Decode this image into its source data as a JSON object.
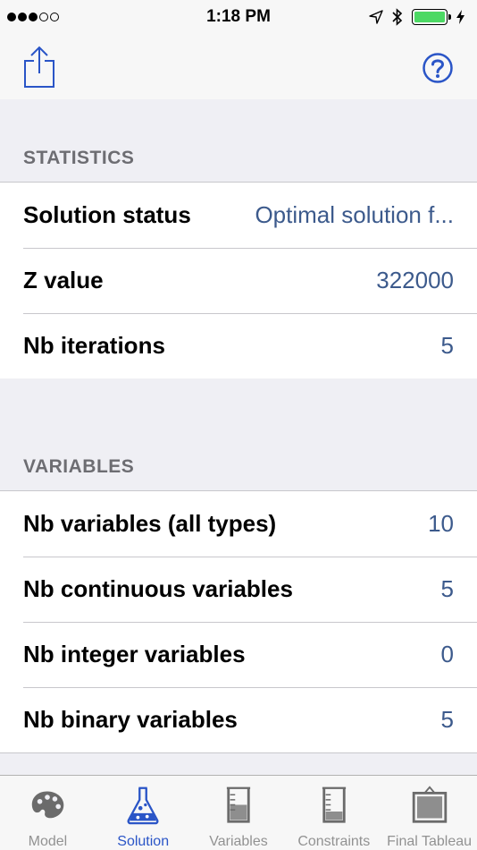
{
  "status_bar": {
    "time": "1:18 PM",
    "battery_color": "#4cd964"
  },
  "toolbar": {
    "share_icon": "share-icon",
    "help_icon": "help-icon"
  },
  "statistics": {
    "header": "STATISTICS",
    "rows": [
      {
        "label": "Solution status",
        "value": "Optimal solution f..."
      },
      {
        "label": "Z value",
        "value": "322000"
      },
      {
        "label": "Nb iterations",
        "value": "5"
      }
    ]
  },
  "variables": {
    "header": "VARIABLES",
    "rows": [
      {
        "label": "Nb variables (all types)",
        "value": "10"
      },
      {
        "label": "Nb continuous variables",
        "value": "5"
      },
      {
        "label": "Nb integer variables",
        "value": "0"
      },
      {
        "label": "Nb binary variables",
        "value": "5"
      }
    ]
  },
  "tabs": [
    {
      "label": "Model",
      "icon": "palette-icon"
    },
    {
      "label": "Solution",
      "icon": "flask-icon",
      "active": true
    },
    {
      "label": "Variables",
      "icon": "beaker-icon"
    },
    {
      "label": "Constraints",
      "icon": "beaker-icon"
    },
    {
      "label": "Final Tableau",
      "icon": "easel-icon"
    }
  ],
  "colors": {
    "accent": "#2a55c7",
    "value_text": "#3c5a8c",
    "header_text": "#6d6d72"
  }
}
